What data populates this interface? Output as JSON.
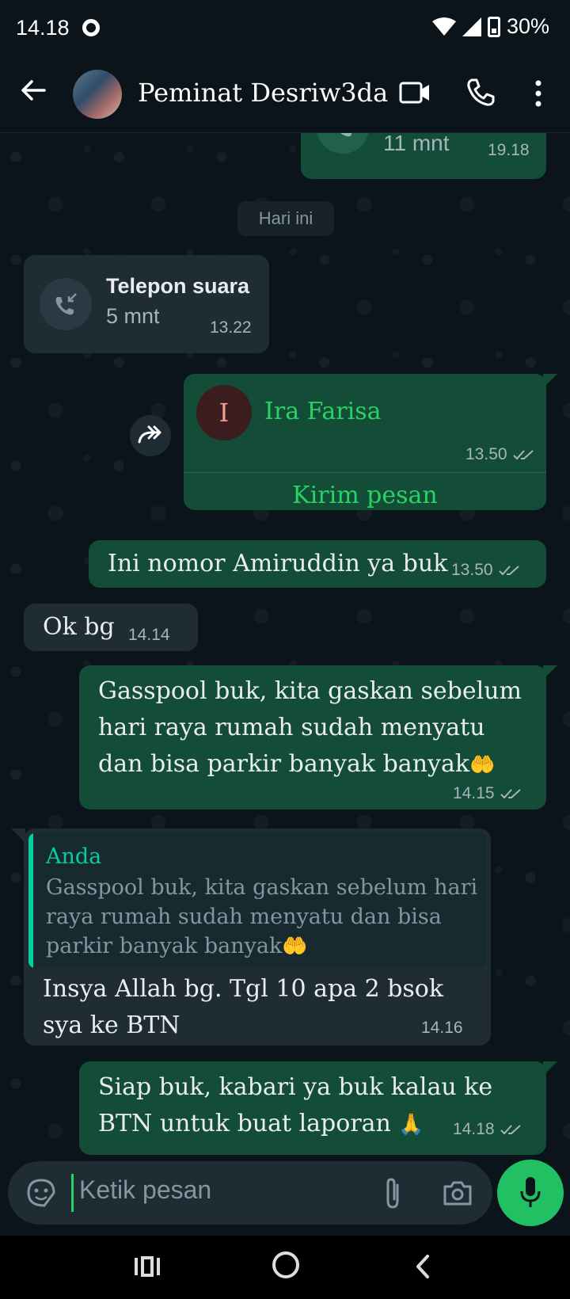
{
  "status_bar": {
    "time": "14.18",
    "battery": "30%"
  },
  "header": {
    "contact_name": "Peminat Desriw3da"
  },
  "chat": {
    "prev_call": {
      "duration": "11 mnt",
      "time": "19.18"
    },
    "date_chip": "Hari ini",
    "voice_call": {
      "title": "Telepon suara",
      "duration": "5 mnt",
      "time": "13.22"
    },
    "shared_contact": {
      "initial": "I",
      "name": "Ira Farisa",
      "time": "13.50",
      "action": "Kirim pesan"
    },
    "messages": [
      {
        "text": "Ini nomor Amiruddin ya buk",
        "time": "13.50"
      },
      {
        "text": "Ok bg",
        "time": "14.14"
      },
      {
        "line1": "Gasspool buk, kita gaskan sebelum",
        "line2": "hari raya rumah sudah menyatu",
        "line3": "dan bisa parkir banyak banyak",
        "emoji": "🤲",
        "time": "14.15"
      },
      {
        "quote_author": "Anda",
        "quote_line1": "Gasspool buk, kita gaskan sebelum hari",
        "quote_line2": "raya rumah sudah menyatu dan bisa",
        "quote_line3": "parkir banyak banyak",
        "quote_emoji": "🤲",
        "line1": "Insya Allah bg. Tgl 10 apa 2 bsok",
        "line2": "sya ke BTN",
        "time": "14.16"
      },
      {
        "line1": "Siap buk, kabari ya buk kalau ke",
        "line2": "BTN untuk buat laporan",
        "emoji": "🙏",
        "time": "14.18"
      }
    ]
  },
  "input": {
    "placeholder": "Ketik pesan"
  },
  "colors": {
    "outgoing": "#144d37",
    "incoming": "#1f2c34",
    "accent": "#25d366",
    "background": "#0b141a"
  },
  "icons": [
    "back-arrow-icon",
    "video-call-icon",
    "phone-icon",
    "more-icon",
    "sticker-icon",
    "attach-icon",
    "camera-icon",
    "mic-icon",
    "forward-icon",
    "read-ticks-icon",
    "missed-call-icon"
  ]
}
